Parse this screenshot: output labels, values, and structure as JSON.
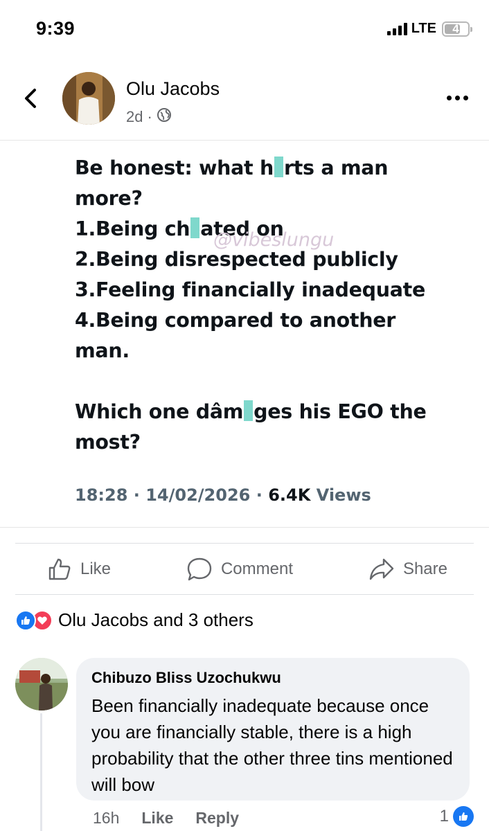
{
  "status_bar": {
    "time": "9:39",
    "network": "LTE",
    "battery": "4"
  },
  "post": {
    "author": "Olu Jacobs",
    "age": "2d",
    "separator": "·",
    "icons": [
      "back-chevron-icon",
      "globe-icon",
      "more-icon"
    ],
    "image": {
      "line1_a": "Be honest: what h",
      "line1_b": "rts a man",
      "line2": "more?",
      "line3_a": "1.Being ch",
      "line3_b": "ated on",
      "line4": "2.Being disrespected publicly",
      "line5": "3.Feeling financially inadequate",
      "line6": "4.Being compared to another",
      "line7": "man.",
      "line8_a": "Which one dâm",
      "line8_b": "ges his EGO the",
      "line9": "most?",
      "watermark": "@vibeslungu",
      "timestamp": "18:28 · 14/02/2026 ·",
      "views_count": "6.4K",
      "views_label": "Views"
    }
  },
  "actions": {
    "like": "Like",
    "comment": "Comment",
    "share": "Share"
  },
  "reactions": {
    "summary": "Olu Jacobs and 3 others",
    "types": [
      "like",
      "love"
    ]
  },
  "comment": {
    "author": "Chibuzo Bliss Uzochukwu",
    "text": "Been financially inadequate because once you are financially stable, there is a high probability that the other three tins mentioned will bow",
    "age": "16h",
    "like": "Like",
    "reply": "Reply",
    "reaction_count": "1"
  },
  "colors": {
    "brand_blue": "#1877f2",
    "love_red": "#f33e58",
    "muted": "#65676b",
    "bubble": "#f0f2f5"
  }
}
